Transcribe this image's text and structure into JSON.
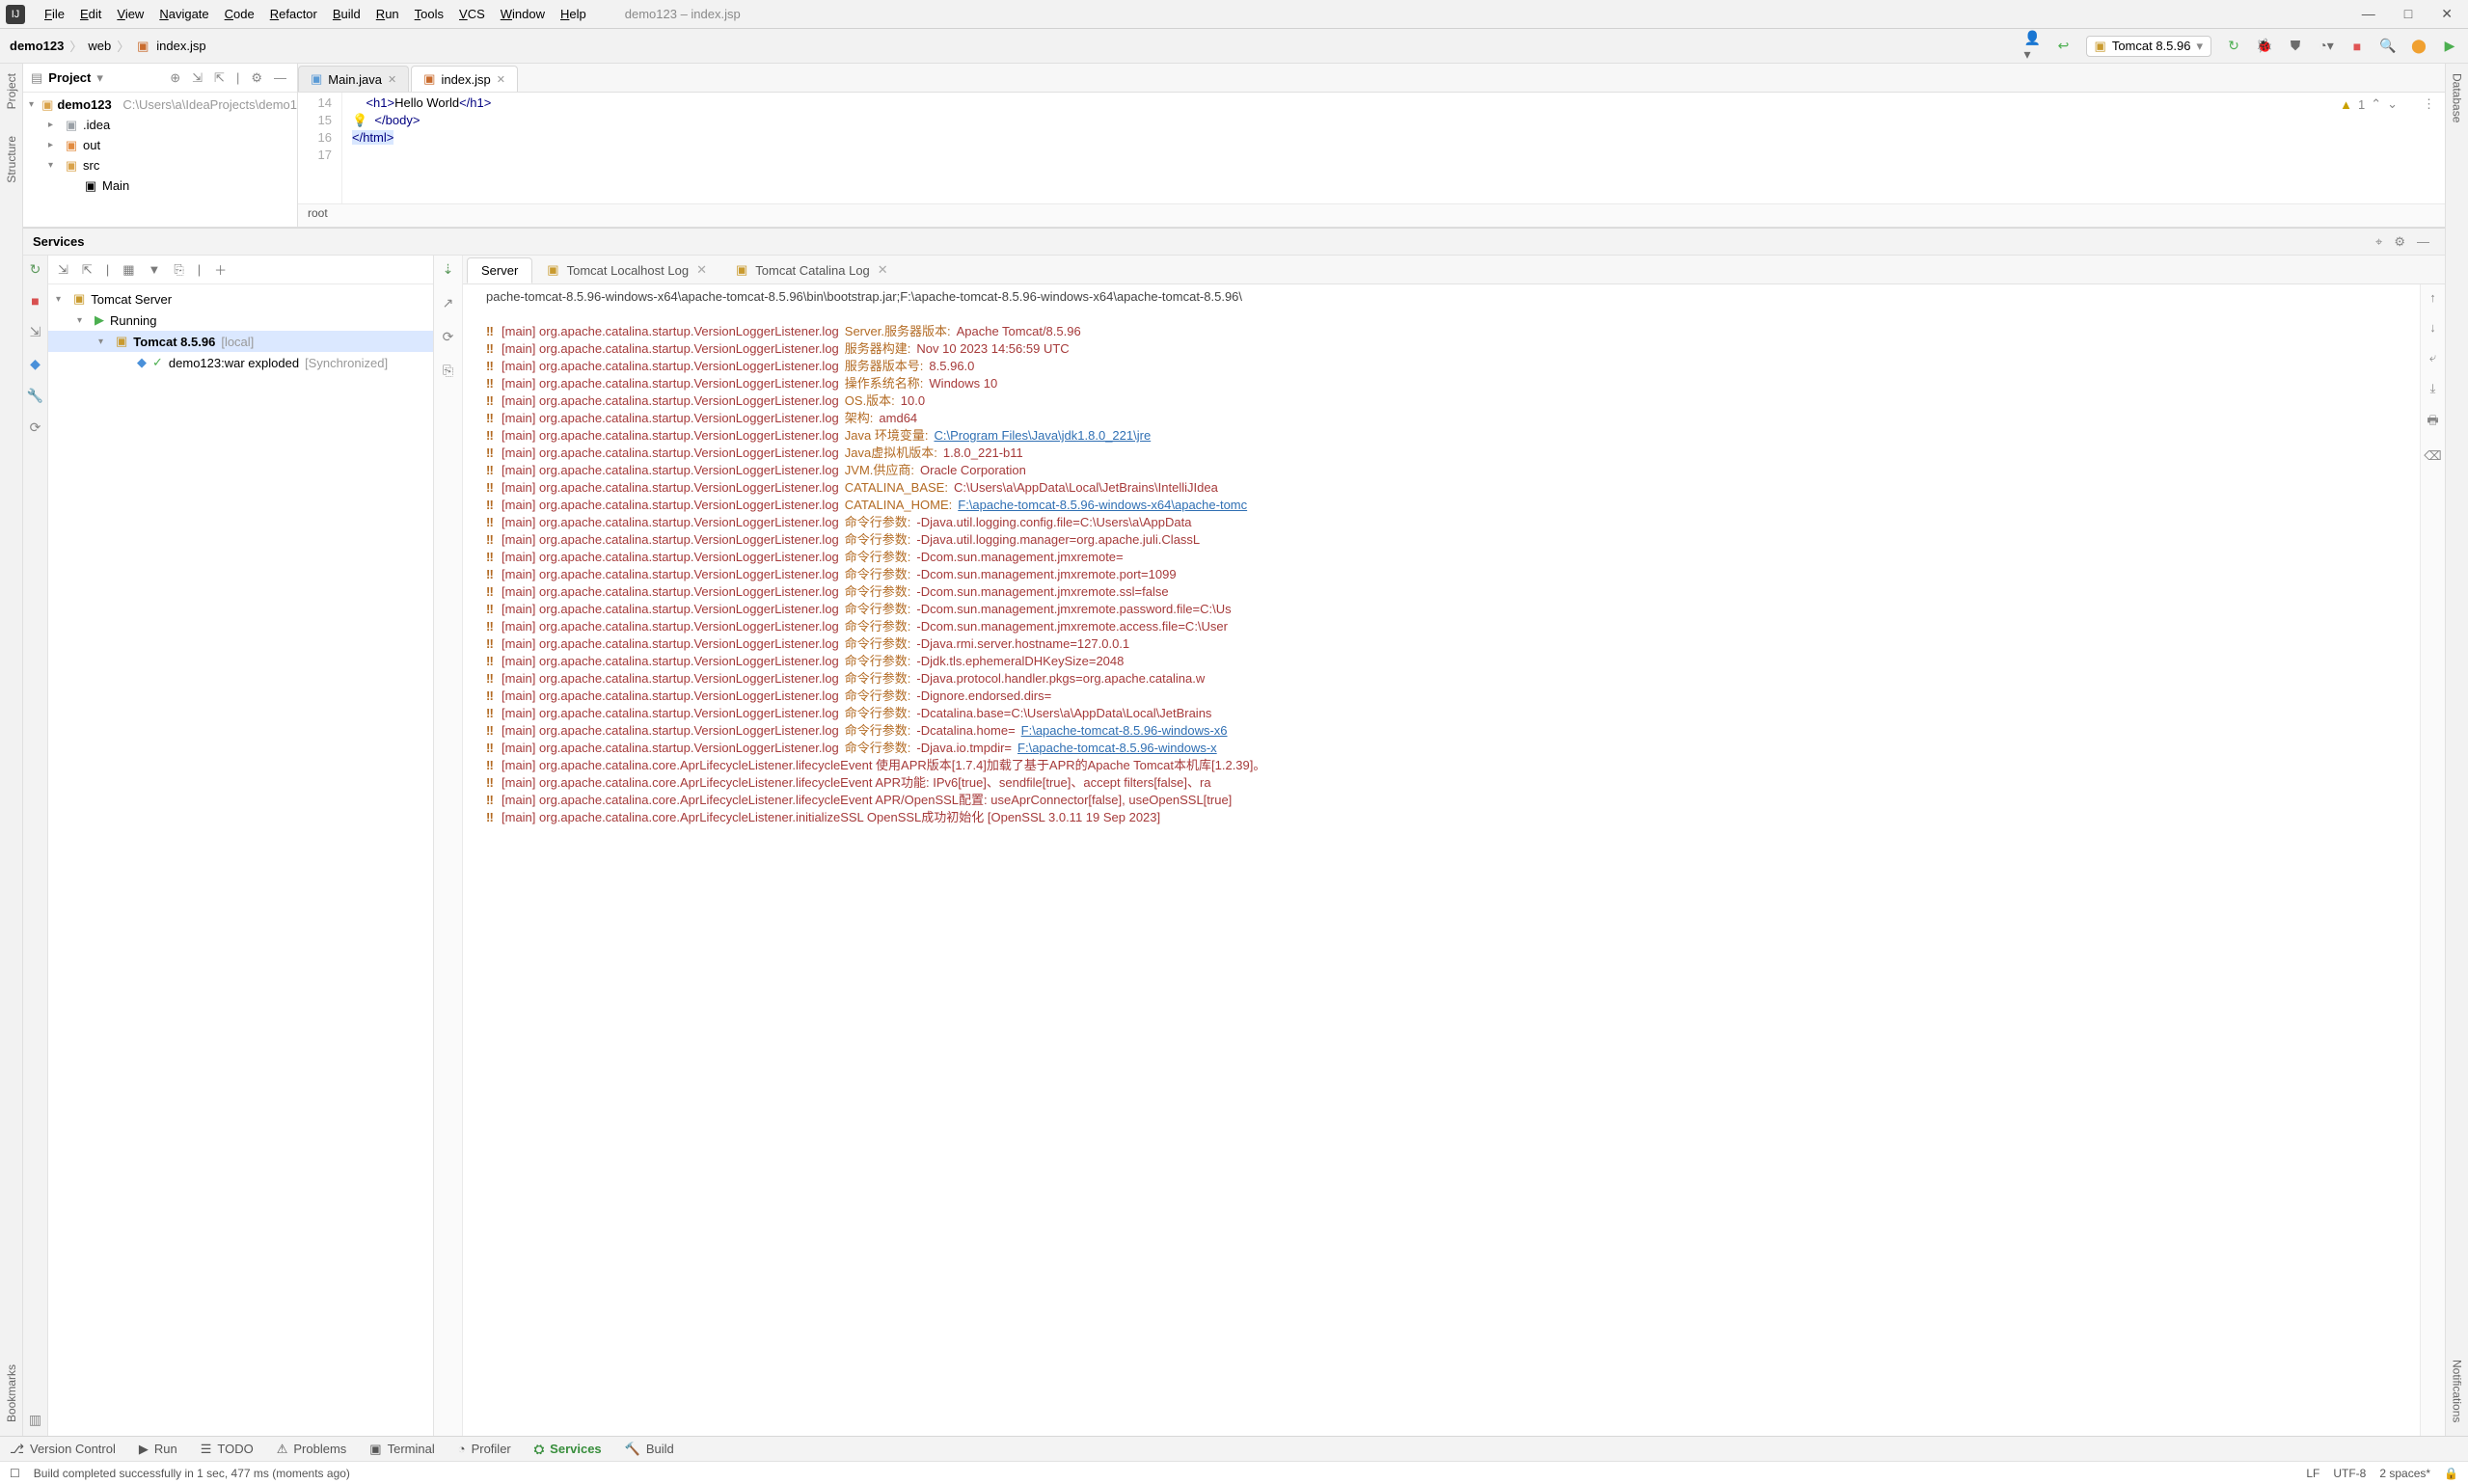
{
  "window": {
    "title_hint": "demo123 – index.jsp"
  },
  "menu": [
    "File",
    "Edit",
    "View",
    "Navigate",
    "Code",
    "Refactor",
    "Build",
    "Run",
    "Tools",
    "VCS",
    "Window",
    "Help"
  ],
  "breadcrumbs": {
    "project": "demo123",
    "folder": "web",
    "file": "index.jsp"
  },
  "toolbar": {
    "run_config": "Tomcat 8.5.96"
  },
  "project_panel": {
    "title": "Project",
    "root": {
      "name": "demo123",
      "path": "C:\\Users\\a\\IdeaProjects\\demo1"
    },
    "children": [
      {
        "name": ".idea",
        "depth": 1,
        "color": "g"
      },
      {
        "name": "out",
        "depth": 1,
        "color": "o"
      },
      {
        "name": "src",
        "depth": 1,
        "color": "y",
        "open": true
      },
      {
        "name": "Main",
        "depth": 2,
        "color": "b"
      }
    ]
  },
  "editor": {
    "tabs": [
      {
        "label": "Main.java",
        "icon": "java",
        "active": false
      },
      {
        "label": "index.jsp",
        "icon": "jsp",
        "active": true
      }
    ],
    "lines": [
      {
        "n": 14,
        "html": "    <h1>Hello World</h1>",
        "tags": true
      },
      {
        "n": 15,
        "html": "  </body>",
        "bulb": true
      },
      {
        "n": 16,
        "html": "</html>",
        "hl": true
      },
      {
        "n": 17,
        "html": ""
      }
    ],
    "warnings": "1",
    "crumb": "root"
  },
  "services": {
    "title": "Services",
    "tree": [
      {
        "label": "Tomcat Server",
        "depth": 0,
        "arrow": "▾",
        "icon": "tomcat"
      },
      {
        "label": "Running",
        "depth": 1,
        "arrow": "▾",
        "icon": "run-green"
      },
      {
        "label": "Tomcat 8.5.96",
        "suffix": "[local]",
        "depth": 2,
        "arrow": "▾",
        "icon": "tomcat",
        "sel": true
      },
      {
        "label": "demo123:war exploded",
        "suffix": "[Synchronized]",
        "depth": 3,
        "arrow": "",
        "icon": "artifact"
      }
    ],
    "tabs": [
      {
        "label": "Server",
        "active": true
      },
      {
        "label": "Tomcat Localhost Log",
        "active": false,
        "closable": true,
        "icon": true
      },
      {
        "label": "Tomcat Catalina Log",
        "active": false,
        "closable": true,
        "icon": true
      }
    ],
    "log_header": "pache-tomcat-8.5.96-windows-x64\\apache-tomcat-8.5.96\\bin\\bootstrap.jar;F:\\apache-tomcat-8.5.96-windows-x64\\apache-tomcat-8.5.96\\",
    "log": [
      {
        "k": "Server.服务器版本:",
        "v": "Apache Tomcat/8.5.96"
      },
      {
        "k": "服务器构建:",
        "v": "Nov 10 2023 14:56:59 UTC"
      },
      {
        "k": "服务器版本号:",
        "v": "8.5.96.0"
      },
      {
        "k": "操作系统名称:",
        "v": "Windows 10"
      },
      {
        "k": "OS.版本:",
        "v": "10.0"
      },
      {
        "k": "架构:",
        "v": "amd64"
      },
      {
        "k": "Java 环境变量:",
        "v": "C:\\Program Files\\Java\\jdk1.8.0_221\\jre",
        "link": true
      },
      {
        "k": "Java虚拟机版本:",
        "v": "1.8.0_221-b11"
      },
      {
        "k": "JVM.供应商:",
        "v": "Oracle Corporation"
      },
      {
        "k": "CATALINA_BASE:",
        "v": "C:\\Users\\a\\AppData\\Local\\JetBrains\\IntelliJIdea"
      },
      {
        "k": "CATALINA_HOME:",
        "v": "F:\\apache-tomcat-8.5.96-windows-x64\\apache-tomc",
        "link": true
      },
      {
        "k": "命令行参数:",
        "v": "-Djava.util.logging.config.file=C:\\Users\\a\\AppData"
      },
      {
        "k": "命令行参数:",
        "v": "-Djava.util.logging.manager=org.apache.juli.ClassL"
      },
      {
        "k": "命令行参数:",
        "v": "-Dcom.sun.management.jmxremote="
      },
      {
        "k": "命令行参数:",
        "v": "-Dcom.sun.management.jmxremote.port=1099"
      },
      {
        "k": "命令行参数:",
        "v": "-Dcom.sun.management.jmxremote.ssl=false"
      },
      {
        "k": "命令行参数:",
        "v": "-Dcom.sun.management.jmxremote.password.file=C:\\Us"
      },
      {
        "k": "命令行参数:",
        "v": "-Dcom.sun.management.jmxremote.access.file=C:\\User"
      },
      {
        "k": "命令行参数:",
        "v": "-Djava.rmi.server.hostname=127.0.0.1"
      },
      {
        "k": "命令行参数:",
        "v": "-Djdk.tls.ephemeralDHKeySize=2048"
      },
      {
        "k": "命令行参数:",
        "v": "-Djava.protocol.handler.pkgs=org.apache.catalina.w"
      },
      {
        "k": "命令行参数:",
        "v": "-Dignore.endorsed.dirs="
      },
      {
        "k": "命令行参数:",
        "v": "-Dcatalina.base=C:\\Users\\a\\AppData\\Local\\JetBrains"
      },
      {
        "k": "命令行参数:",
        "v": "-Dcatalina.home=",
        "tail": "F:\\apache-tomcat-8.5.96-windows-x6",
        "link": true
      },
      {
        "k": "命令行参数:",
        "v": "-Djava.io.tmpdir=",
        "tail": "F:\\apache-tomcat-8.5.96-windows-x",
        "link": true
      }
    ],
    "log_class_prefix": "[main] org.apache.catalina.startup.VersionLoggerListener.log",
    "log_extra": [
      "[main] org.apache.catalina.core.AprLifecycleListener.lifecycleEvent 使用APR版本[1.7.4]加载了基于APR的Apache Tomcat本机库[1.2.39]。",
      "[main] org.apache.catalina.core.AprLifecycleListener.lifecycleEvent APR功能: IPv6[true]、sendfile[true]、accept filters[false]、ra",
      "[main] org.apache.catalina.core.AprLifecycleListener.lifecycleEvent APR/OpenSSL配置: useAprConnector[false], useOpenSSL[true]",
      "[main] org.apache.catalina.core.AprLifecycleListener.initializeSSL OpenSSL成功初始化 [OpenSSL 3.0.11 19 Sep 2023]"
    ]
  },
  "tool_windows": [
    {
      "label": "Version Control",
      "icon": "branch"
    },
    {
      "label": "Run",
      "icon": "play"
    },
    {
      "label": "TODO",
      "icon": "todo"
    },
    {
      "label": "Problems",
      "icon": "warn"
    },
    {
      "label": "Terminal",
      "icon": "term"
    },
    {
      "label": "Profiler",
      "icon": "prof"
    },
    {
      "label": "Services",
      "icon": "srv",
      "active": true
    },
    {
      "label": "Build",
      "icon": "build"
    }
  ],
  "status": {
    "message": "Build completed successfully in 1 sec, 477 ms (moments ago)",
    "lf": "LF",
    "encoding": "UTF-8",
    "indent": "2 spaces*"
  }
}
